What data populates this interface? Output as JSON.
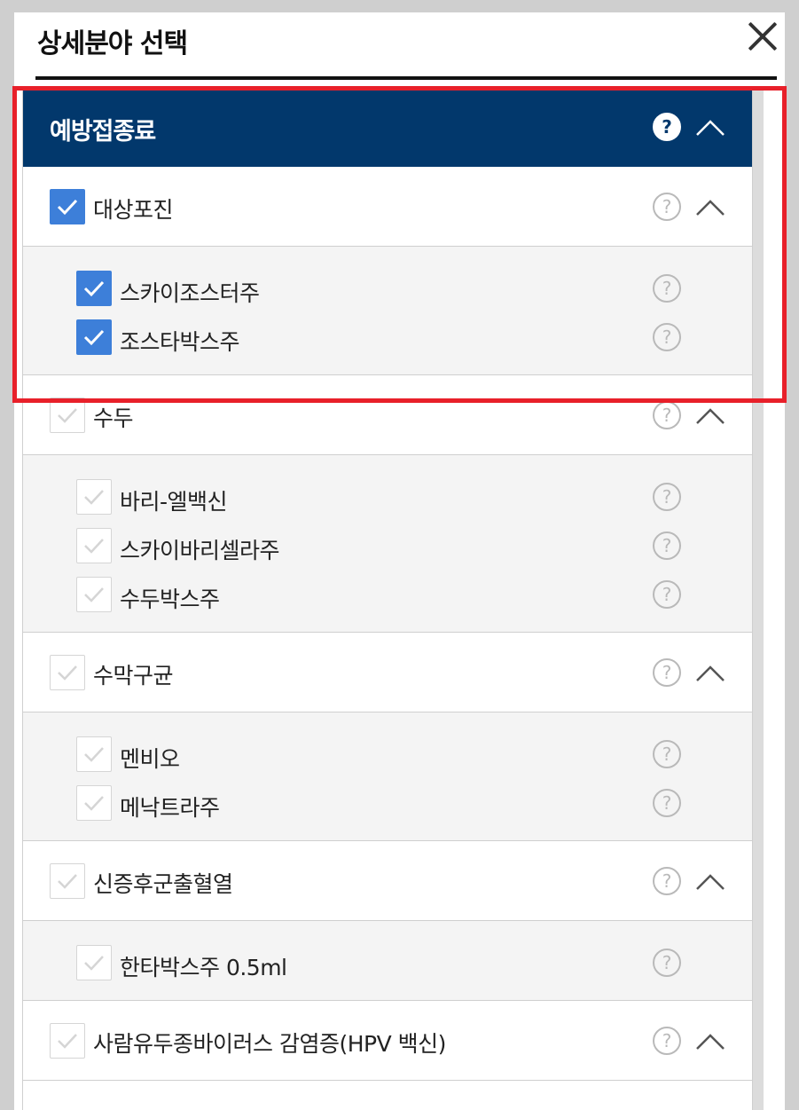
{
  "modal": {
    "title": "상세분야 선택"
  },
  "header": {
    "label": "예방접종료"
  },
  "groups": [
    {
      "label": "대상포진",
      "checked": true,
      "items": [
        {
          "label": "스카이조스터주",
          "checked": true
        },
        {
          "label": "조스타박스주",
          "checked": true
        }
      ]
    },
    {
      "label": "수두",
      "checked": false,
      "items": [
        {
          "label": "바리-엘백신",
          "checked": false
        },
        {
          "label": "스카이바리셀라주",
          "checked": false
        },
        {
          "label": "수두박스주",
          "checked": false
        }
      ]
    },
    {
      "label": "수막구균",
      "checked": false,
      "items": [
        {
          "label": "멘비오",
          "checked": false
        },
        {
          "label": "메낙트라주",
          "checked": false
        }
      ]
    },
    {
      "label": "신증후군출혈열",
      "checked": false,
      "items": [
        {
          "label": "한타박스주 0.5ml",
          "checked": false
        }
      ]
    },
    {
      "label": "사람유두종바이러스 감염증(HPV 백신)",
      "checked": false,
      "items": []
    }
  ],
  "icons": {
    "help": "?",
    "close": "close-icon",
    "collapse": "chevron-up-icon"
  },
  "colors": {
    "header_bg": "#02386c",
    "checkbox_checked": "#3d7fd9",
    "highlight": "#e8202a"
  }
}
